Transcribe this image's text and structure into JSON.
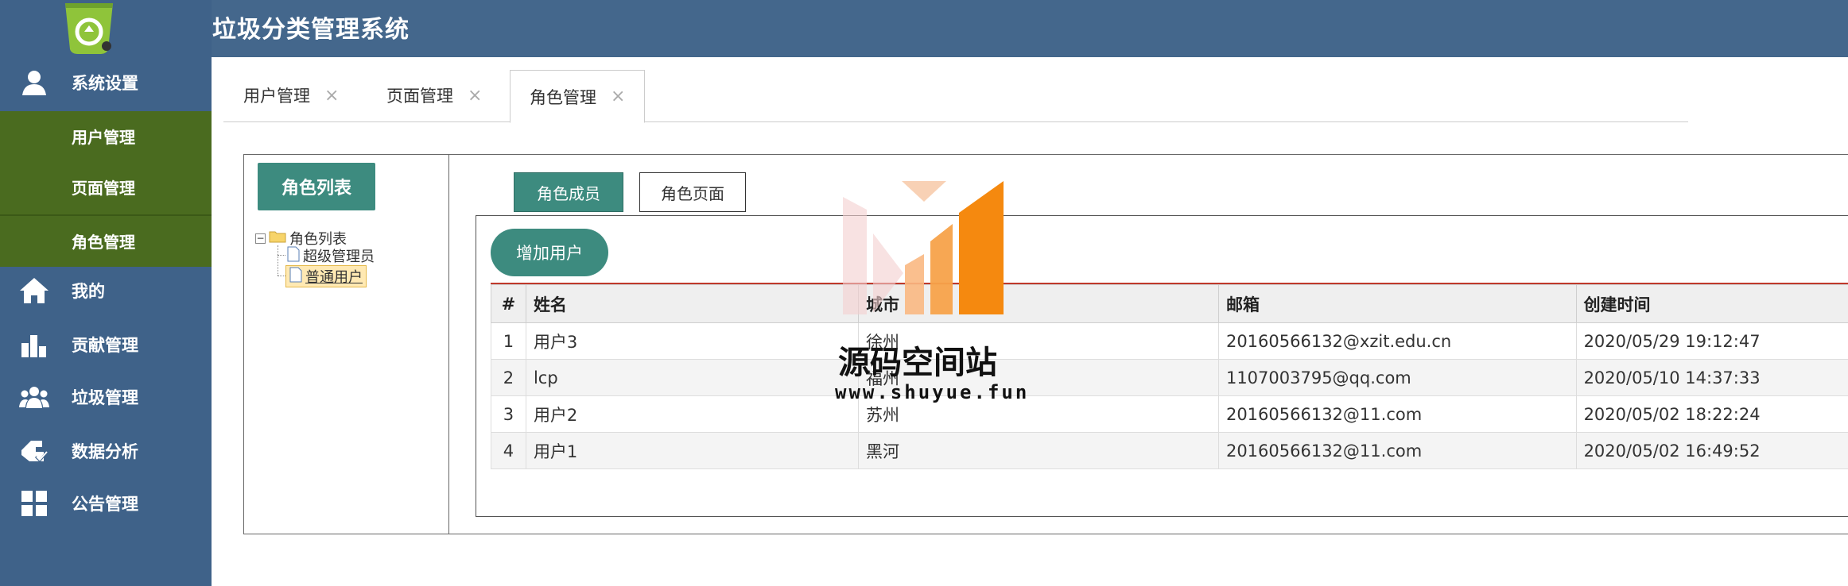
{
  "header": {
    "title": "垃圾分类管理系统"
  },
  "sidebar": {
    "items": [
      {
        "label": "系统设置",
        "icon": "user-icon"
      },
      {
        "label": "我的",
        "icon": "home-icon"
      },
      {
        "label": "贡献管理",
        "icon": "bar-chart-icon"
      },
      {
        "label": "垃圾管理",
        "icon": "group-icon"
      },
      {
        "label": "数据分析",
        "icon": "hand-check-icon"
      },
      {
        "label": "公告管理",
        "icon": "grid-icon"
      }
    ],
    "sub_items": [
      {
        "label": "用户管理"
      },
      {
        "label": "页面管理"
      },
      {
        "label": "角色管理"
      }
    ]
  },
  "tabs": [
    {
      "label": "用户管理",
      "close": "×"
    },
    {
      "label": "页面管理",
      "close": "×"
    },
    {
      "label": "角色管理",
      "close": "×",
      "active": true
    }
  ],
  "role_panel": {
    "button_label": "角色列表",
    "tree": {
      "root": "角色列表",
      "children": [
        "超级管理员",
        "普通用户"
      ],
      "selected": "普通用户"
    }
  },
  "inner_tabs": {
    "members": "角色成员",
    "pages": "角色页面"
  },
  "add_user_label": "增加用户",
  "table": {
    "columns": [
      "#",
      "姓名",
      "城市",
      "邮箱",
      "创建时间"
    ],
    "rows": [
      [
        "1",
        "用户3",
        "徐州",
        "20160566132@xzit.edu.cn",
        "2020/05/29 19:12:47"
      ],
      [
        "2",
        "lcp",
        "福州",
        "1107003795@qq.com",
        "2020/05/10 14:37:33"
      ],
      [
        "3",
        "用户2",
        "苏州",
        "20160566132@11.com",
        "2020/05/02 18:22:24"
      ],
      [
        "4",
        "用户1",
        "黑河",
        "20160566132@11.com",
        "2020/05/02 16:49:52"
      ]
    ]
  },
  "watermark": {
    "title": "源码空间站",
    "url": "www.shuyue.fun"
  },
  "colors": {
    "sidebar": "#3f6289",
    "submenu": "#4a6b1f",
    "accent": "#3d8b7f",
    "header": "#44678c"
  }
}
